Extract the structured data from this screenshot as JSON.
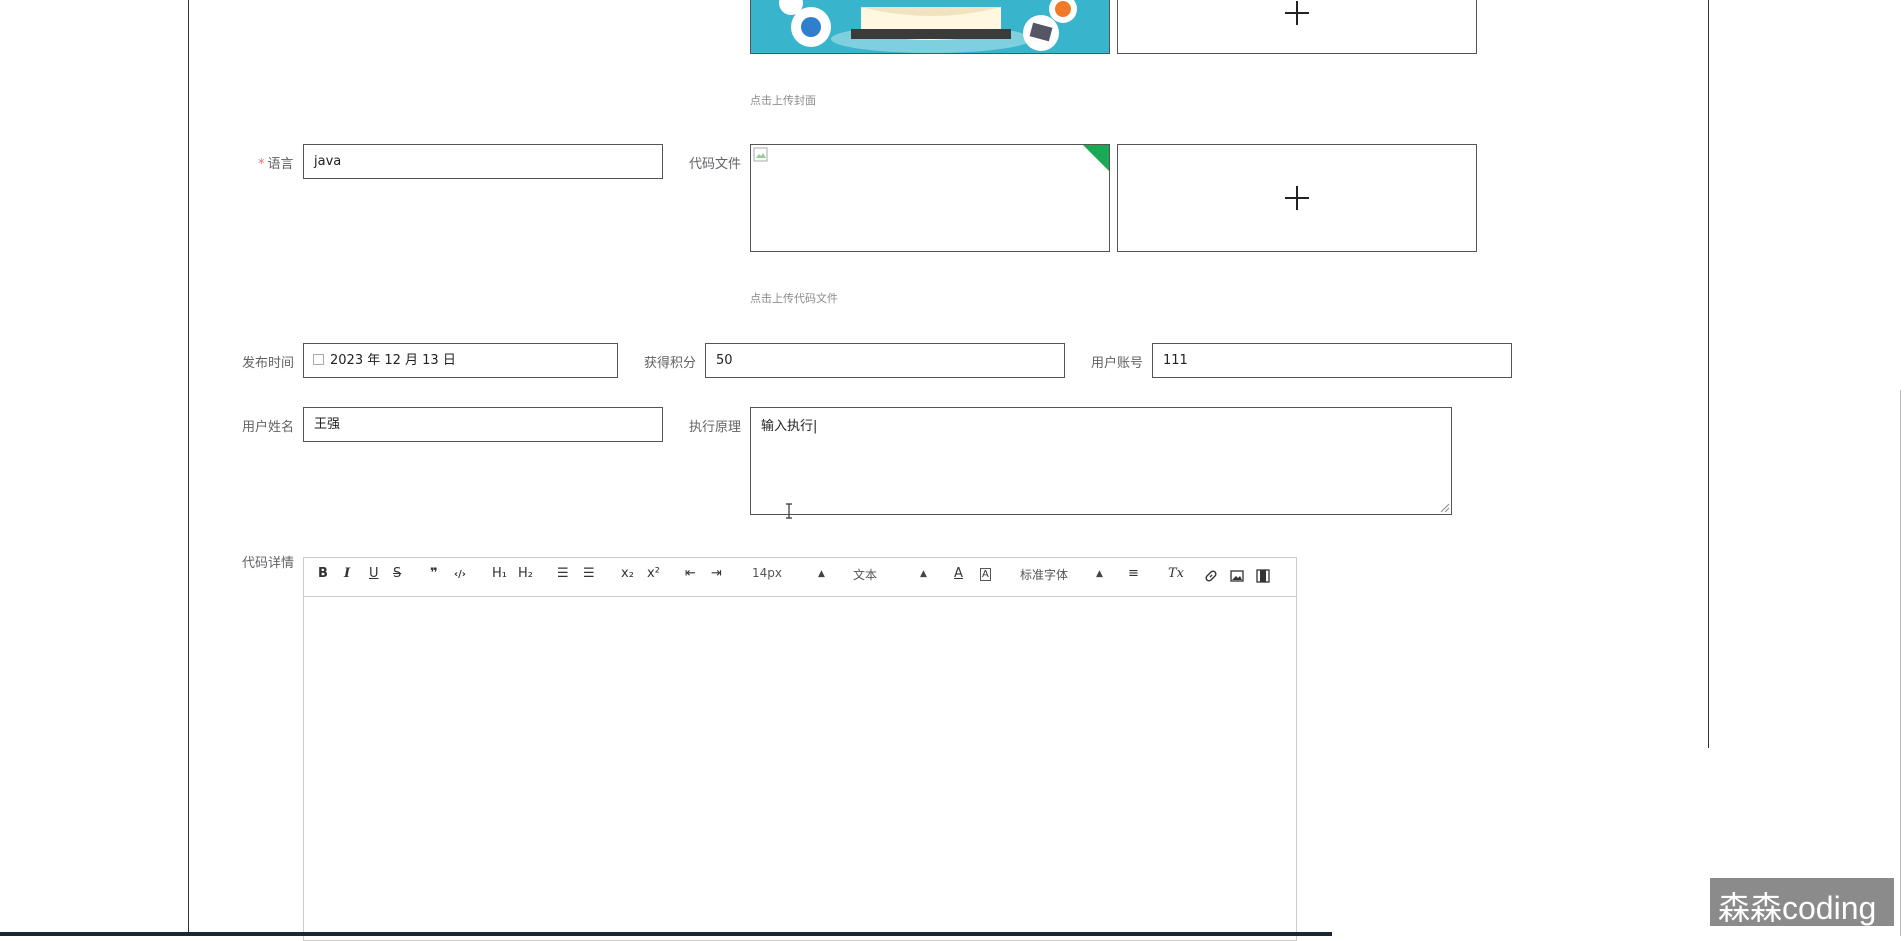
{
  "form": {
    "cover_hint": "点击上传封面",
    "language": {
      "required_mark": "*",
      "label": "语言",
      "value": "java"
    },
    "code_file": {
      "label": "代码文件",
      "hint": "点击上传代码文件"
    },
    "publish_time": {
      "label": "发布时间",
      "value": "2023 年 12 月 13 日"
    },
    "points": {
      "label": "获得积分",
      "value": "50"
    },
    "user_account": {
      "label": "用户账号",
      "value": "111"
    },
    "user_name": {
      "label": "用户姓名",
      "value": "王强"
    },
    "principle": {
      "label": "执行原理",
      "value": "输入执行|"
    },
    "code_detail": {
      "label": "代码详情"
    }
  },
  "editor": {
    "toolbar": {
      "bold": "B",
      "italic": "I",
      "underline": "U",
      "strike": "S",
      "blockquote": "❞",
      "code_block": "‹/›",
      "h1": "H₁",
      "h2": "H₂",
      "ordered_list": "☰",
      "bullet_list": "☰",
      "subscript": "x₂",
      "superscript": "x²",
      "outdent": "⇤",
      "indent": "⇥",
      "size": "14px",
      "header": "文本",
      "font_color": "A",
      "background_color": "A",
      "font": "标准字体",
      "align": "≡",
      "clean": "Tx"
    }
  },
  "watermark": "森森coding",
  "colors": {
    "accent_green": "#1aaa55",
    "required_red": "#f56c6c",
    "label_gray": "#606266"
  }
}
